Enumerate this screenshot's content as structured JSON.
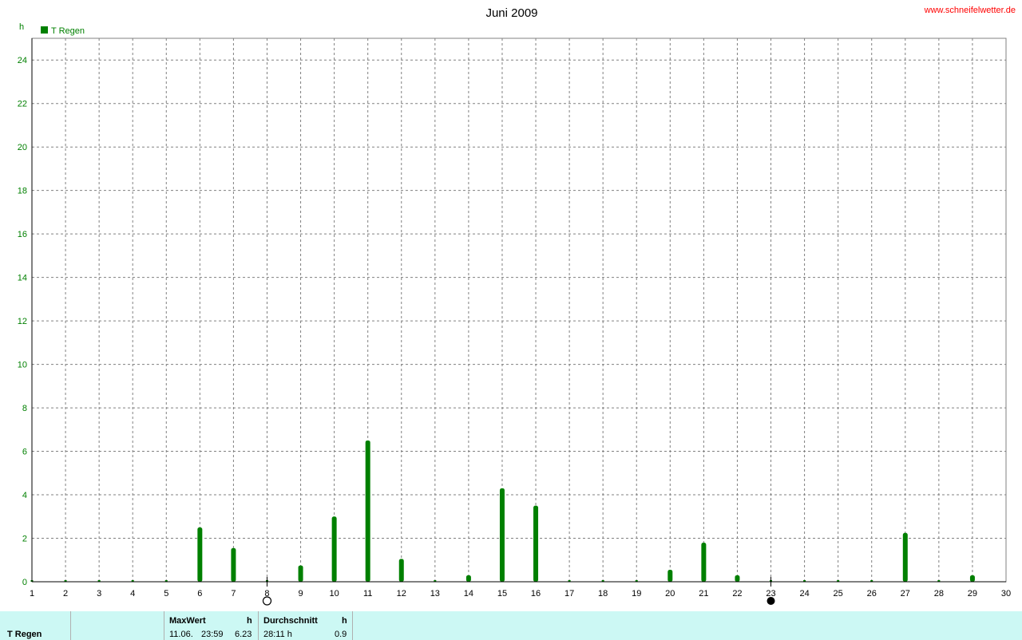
{
  "header": {
    "watermark": "www.schneifelwetter.de"
  },
  "chart_data": {
    "type": "bar",
    "title": "Juni 2009",
    "ylabel": "h",
    "xlim": [
      1,
      30
    ],
    "ylim": [
      0,
      25
    ],
    "yticks": [
      0,
      2,
      4,
      6,
      8,
      10,
      12,
      14,
      16,
      18,
      20,
      22,
      24
    ],
    "xticks": [
      1,
      2,
      3,
      4,
      5,
      6,
      7,
      8,
      9,
      10,
      11,
      12,
      13,
      14,
      15,
      16,
      17,
      18,
      19,
      20,
      21,
      22,
      23,
      24,
      25,
      26,
      27,
      28,
      29,
      30
    ],
    "grid": true,
    "legend": "top-left",
    "moon_markers": [
      {
        "day": 8,
        "phase": "full-moon-icon"
      },
      {
        "day": 23,
        "phase": "new-moon-icon"
      }
    ],
    "colors": {
      "bar": "#008000",
      "axis_text": "#008000",
      "grid": "#808080"
    },
    "series": [
      {
        "name": "T Regen",
        "x": [
          1,
          2,
          3,
          4,
          5,
          6,
          7,
          8,
          9,
          10,
          11,
          12,
          13,
          14,
          15,
          16,
          17,
          18,
          19,
          20,
          21,
          22,
          23,
          24,
          25,
          26,
          27,
          28,
          29
        ],
        "values": [
          0,
          0,
          0,
          0,
          0,
          2.5,
          1.55,
          0,
          0.75,
          3.0,
          6.5,
          1.05,
          0,
          0.3,
          4.3,
          3.5,
          0,
          0,
          0,
          0.55,
          1.8,
          0.3,
          0,
          0,
          0,
          0,
          2.25,
          0,
          0.3
        ]
      }
    ]
  },
  "footer": {
    "row_label": "T Regen",
    "max_header": "MaxWert",
    "max_unit": "h",
    "max_date": "11.06.",
    "max_time": "23:59",
    "max_value": "6.23",
    "avg_header": "Durchschnitt",
    "avg_unit": "h",
    "avg_time": "28:11 h",
    "avg_value": "0.9"
  }
}
